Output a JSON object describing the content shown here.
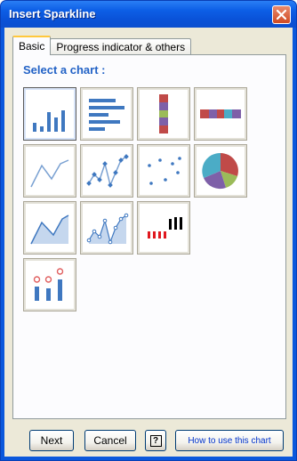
{
  "window": {
    "title": "Insert Sparkline"
  },
  "tabs": [
    {
      "label": "Basic",
      "active": true
    },
    {
      "label": "Progress indicator & others",
      "active": false
    }
  ],
  "panel": {
    "heading": "Select a chart :"
  },
  "charts": [
    {
      "name": "column",
      "icon": "column-chart-icon"
    },
    {
      "name": "bar",
      "icon": "bar-chart-icon"
    },
    {
      "name": "stacked-column",
      "icon": "stacked-column-icon"
    },
    {
      "name": "stacked-bar",
      "icon": "stacked-bar-icon"
    },
    {
      "name": "line",
      "icon": "line-chart-icon"
    },
    {
      "name": "line-markers",
      "icon": "line-markers-icon"
    },
    {
      "name": "scatter",
      "icon": "scatter-chart-icon"
    },
    {
      "name": "pie",
      "icon": "pie-chart-icon"
    },
    {
      "name": "area",
      "icon": "area-chart-icon"
    },
    {
      "name": "area-markers",
      "icon": "area-markers-icon"
    },
    {
      "name": "win-loss",
      "icon": "win-loss-icon"
    },
    {
      "name": "bullet-bar",
      "icon": "bullet-bar-icon"
    }
  ],
  "buttons": {
    "next": "Next",
    "cancel": "Cancel",
    "help": "?",
    "how_to": "How to use this chart"
  },
  "colors": {
    "title_bar": "#0b58dc",
    "dialog_bg": "#ece9d8",
    "heading": "#2262c6",
    "chart_blue": "#3f78c0"
  }
}
